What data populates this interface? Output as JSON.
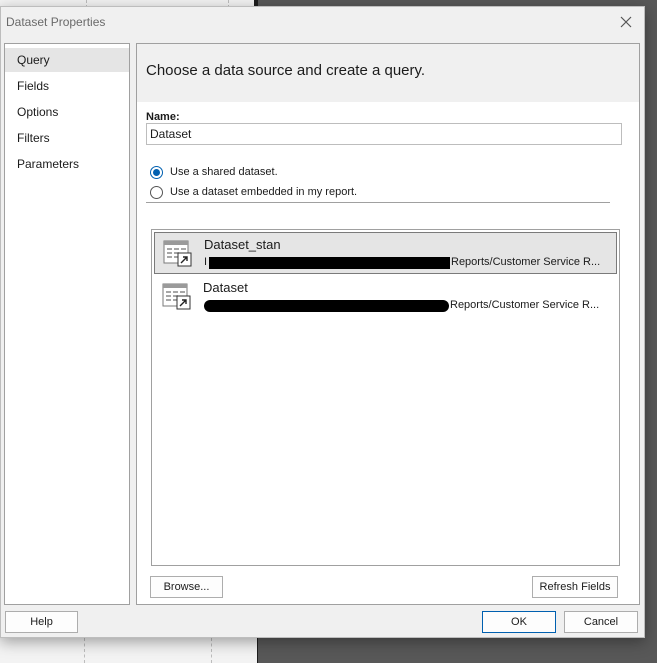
{
  "dialog": {
    "title": "Dataset Properties"
  },
  "sidebar": {
    "items": [
      {
        "label": "Query",
        "selected": true
      },
      {
        "label": "Fields",
        "selected": false
      },
      {
        "label": "Options",
        "selected": false
      },
      {
        "label": "Filters",
        "selected": false
      },
      {
        "label": "Parameters",
        "selected": false
      }
    ]
  },
  "main": {
    "header": "Choose a data source and create a query.",
    "name_label": "Name:",
    "name_value": "Dataset",
    "radio_shared": "Use a shared dataset.",
    "radio_embedded": "Use a dataset embedded in my report.",
    "datasets": [
      {
        "name": "Dataset_stan",
        "path_visible": "Reports/Customer Service R...",
        "path_prefix": "I"
      },
      {
        "name": "Dataset",
        "path_visible": "Reports/Customer Service R..."
      }
    ],
    "browse_label": "Browse...",
    "refresh_label": "Refresh Fields"
  },
  "footer": {
    "help_label": "Help",
    "ok_label": "OK",
    "cancel_label": "Cancel"
  },
  "colors": {
    "accent": "#0060b0",
    "selection": "#e5e5e5",
    "redaction": "#000000"
  },
  "icons": {
    "close": "close-icon",
    "dataset": "shared-dataset-icon"
  }
}
